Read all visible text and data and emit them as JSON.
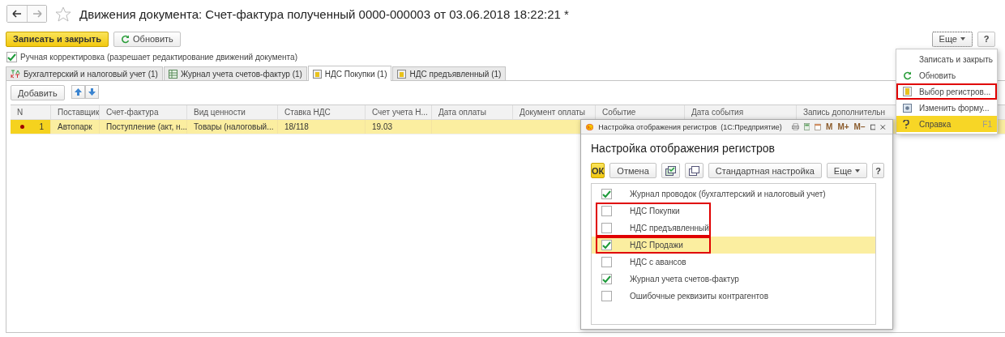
{
  "window": {
    "title": "Движения документа: Счет-фактура полученный 0000-000003 от 03.06.2018 18:22:21 *",
    "favorite": false
  },
  "toolbar": {
    "primary": "Записать и закрыть",
    "refresh": "Обновить",
    "more": "Еще",
    "help": "?"
  },
  "manual": {
    "label": "Ручная корректировка (разрешает редактирование движений документа)",
    "checked": true
  },
  "tabs": [
    {
      "label": "Бухгалтерский и налоговый учет (1)",
      "selected": false
    },
    {
      "label": "Журнал учета счетов-фактур (1)",
      "selected": false
    },
    {
      "label": "НДС Покупки (1)",
      "selected": true
    },
    {
      "label": "НДС предъявленный (1)",
      "selected": false
    }
  ],
  "panel": {
    "add": "Добавить"
  },
  "table": {
    "columns": [
      "N",
      "Поставщик",
      "Счет-фактура",
      "Вид ценности",
      "Ставка НДС",
      "Счет учета Н...",
      "Дата оплаты",
      "Документ оплаты",
      "Событие",
      "Дата события",
      "Запись дополнительн"
    ],
    "rows": [
      {
        "selected": true,
        "marked": true,
        "cells": [
          "1",
          "Автопарк",
          "Поступление (акт, н...",
          "Товары (налоговый...",
          "18/118",
          "19.03"
        ]
      }
    ]
  },
  "menu": {
    "items": [
      {
        "label": "Записать и закрыть",
        "highlighted": false,
        "outlined": false
      },
      {
        "label": "Обновить",
        "highlighted": false,
        "outlined": false
      },
      {
        "label": "Выбор регистров...",
        "highlighted": false,
        "outlined": true
      },
      {
        "label": "Изменить форму...",
        "highlighted": false,
        "outlined": false
      },
      {
        "label": "Справка",
        "shortcut": "F1",
        "highlighted": true,
        "outlined": false
      }
    ]
  },
  "dialog": {
    "window_title": "Настройка отображения регистров  (1С:Предприятие)",
    "title_buttons": [
      "M",
      "M+",
      "M−"
    ],
    "heading": "Настройка отображения регистров",
    "ok": "ОК",
    "cancel": "Отмена",
    "standard": "Стандартная настройка",
    "more": "Еще",
    "help": "?",
    "groups": [
      {
        "outlined": false,
        "items": [
          {
            "label": "Журнал проводок (бухгалтерский и налоговый учет)",
            "checked": true,
            "selected": false
          }
        ]
      },
      {
        "outlined": true,
        "items": [
          {
            "label": "НДС Покупки",
            "checked": false,
            "selected": false
          },
          {
            "label": "НДС предъявленный",
            "checked": false,
            "selected": false
          }
        ]
      },
      {
        "outlined": true,
        "items": [
          {
            "label": "НДС Продажи",
            "checked": true,
            "selected": true
          }
        ]
      },
      {
        "outlined": false,
        "items": [
          {
            "label": "НДС с авансов",
            "checked": false,
            "selected": false
          },
          {
            "label": "Журнал учета счетов-фактур",
            "checked": true,
            "selected": false
          },
          {
            "label": "Ошибочные реквизиты контрагентов",
            "checked": false,
            "selected": false
          }
        ]
      }
    ]
  }
}
